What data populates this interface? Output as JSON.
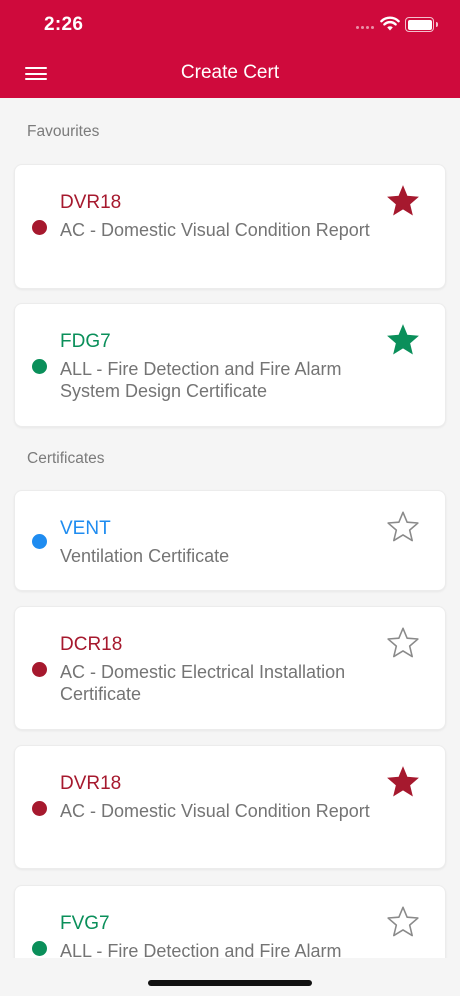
{
  "status_bar": {
    "time": "2:26"
  },
  "header": {
    "title": "Create Cert",
    "menu_icon": "hamburger-menu-icon"
  },
  "sections": {
    "favourites": "Favourites",
    "certificates": "Certificates"
  },
  "favourites": [
    {
      "code": "DVR18",
      "description": "AC - Domestic Visual Condition Report",
      "color": "#a6192e",
      "starred": true
    },
    {
      "code": "FDG7",
      "description": "ALL - Fire Detection and Fire Alarm System Design Certificate",
      "color": "#0a8f5a",
      "starred": true
    }
  ],
  "certificates": [
    {
      "code": "VENT",
      "description": "Ventilation Certificate",
      "color": "#1f8cf0",
      "starred": false
    },
    {
      "code": "DCR18",
      "description": "AC - Domestic Electrical Installation Certificate",
      "color": "#a6192e",
      "starred": false
    },
    {
      "code": "DVR18",
      "description": "AC - Domestic Visual Condition Report",
      "color": "#a6192e",
      "starred": true
    },
    {
      "code": "FVG7",
      "description": "ALL - Fire Detection and Fire Alarm",
      "color": "#0a8f5a",
      "starred": false
    }
  ],
  "colors": {
    "header": "#cf0a3c",
    "unstarred_outline": "#8a8a8a"
  }
}
